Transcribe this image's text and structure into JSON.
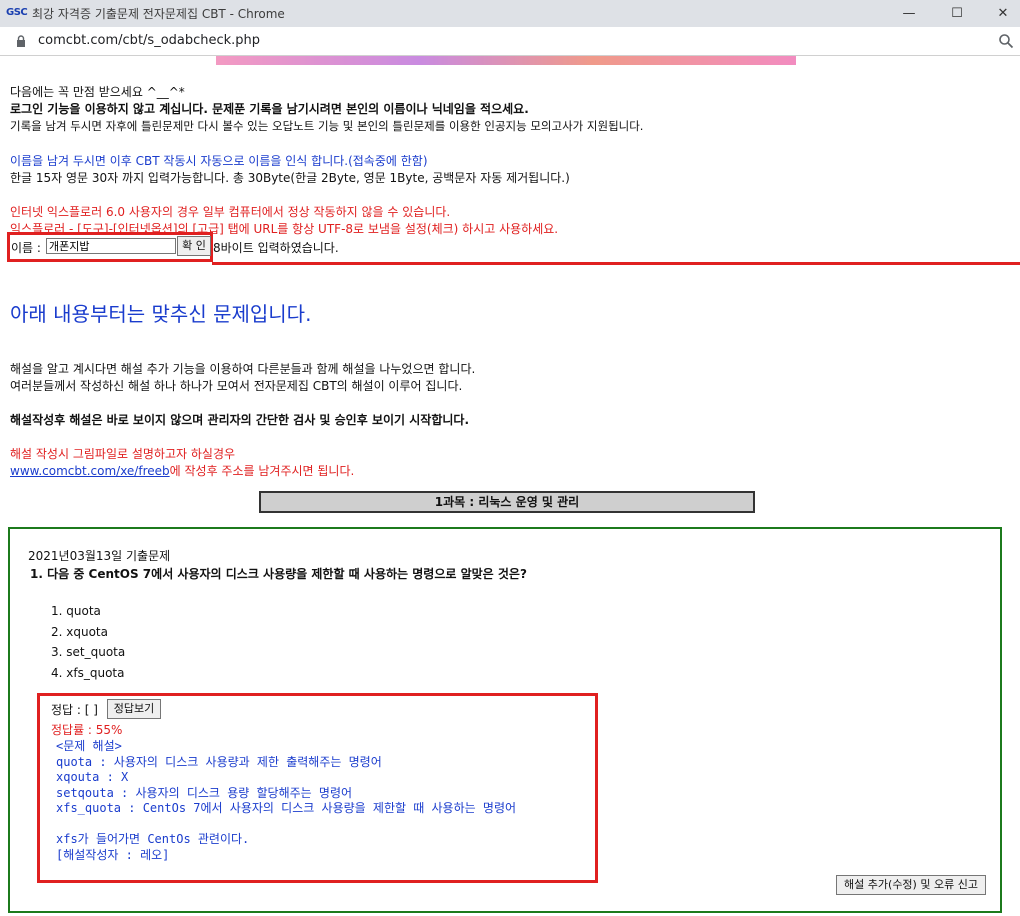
{
  "window": {
    "logo_text": "GSC",
    "title": "최강 자격증 기출문제 전자문제집 CBT - Chrome",
    "minimize": "—",
    "maximize": "☐",
    "close": "✕"
  },
  "address": {
    "url": "comcbt.com/cbt/s_odabcheck.php"
  },
  "notice": {
    "line1": "다음에는 꼭 만점 받으세요 ^__^*",
    "line2": "로그인 기능을 이용하지 않고 계십니다. 문제푼 기록을 남기시려면 본인의 이름이나 닉네임을 적으세요.",
    "line3": "기록을 남겨 두시면 자후에 틀린문제만 다시 볼수 있는 오답노트 기능 및 본인의 틀린문제를 이용한 인공지능 모의고사가 지원됩니다.",
    "line4": "이름을 남겨 두시면 이후 CBT 작동시 자동으로 이름을 인식 합니다.(접속중에 한함)",
    "line5": "한글 15자 영문 30자 까지 입력가능합니다. 총 30Byte(한글 2Byte, 영문 1Byte, 공백문자 자동 제거됩니다.)",
    "line6": "인터넷 익스플로러 6.0 사용자의 경우 일부 컴퓨터에서 정상 작동하지 않을 수 있습니다.",
    "line7": "익스플로러 - [도구]-[인터넷옵션]의 [고급] 탭에 URL를 항상 UTF-8로 보냄을 설정(체크) 하시고 사용하세요."
  },
  "name_form": {
    "label": "이름 :",
    "value": "개폰지밥",
    "confirm_label": "확 인",
    "byte_msg": "8바이트 입력하였습니다."
  },
  "intro": {
    "heading": "아래 내용부터는 맞추신 문제입니다.",
    "p1": "해설을 알고 계시다면 해설 추가 기능을 이용하여 다른분들과 함께 해설을 나누었으면 합니다.",
    "p2": "여러분들께서 작성하신 해설 하나 하나가 모여서 전자문제집 CBT의 해설이 이루어 집니다.",
    "p3": "해설작성후 해설은 바로 보이지 않으며 관리자의 간단한 검사 및 승인후 보이기 시작합니다.",
    "p4": "해설 작성시 그림파일로 설명하고자 하실경우",
    "link": "www.comcbt.com/xe/freeb",
    "p5": "에 작성후 주소를 남겨주시면 됩니다."
  },
  "subject": {
    "title": "1과목 : 리눅스 운영 및 관리"
  },
  "question": {
    "exam_date": "2021년03월13일 기출문제",
    "text": "1. 다음 중 CentOS 7에서 사용자의 디스크 사용량을 제한할 때 사용하는 명령으로 알맞은 것은?",
    "options": [
      "1. quota",
      "2. xquota",
      "3. set_quota",
      "4. xfs_quota"
    ],
    "answer_label": "정답 : [ ]",
    "show_answer_label": "정답보기",
    "correct_rate": "정답률 : 55%",
    "explanation": [
      "<문제 해설>",
      "quota : 사용자의 디스크 사용량과 제한 출력해주는 명령어",
      "xqouta : X",
      "setqouta : 사용자의 디스크 용량 할당해주는 명령어",
      "xfs_quota : CentOs 7에서 사용자의 디스크 사용량을 제한할 때 사용하는 명령어",
      "",
      "xfs가 들어가면 CentOs 관련이다.",
      "[해설작성자 : 레오]"
    ],
    "add_explanation_label": "해설 추가(수정) 및 오류 신고"
  }
}
